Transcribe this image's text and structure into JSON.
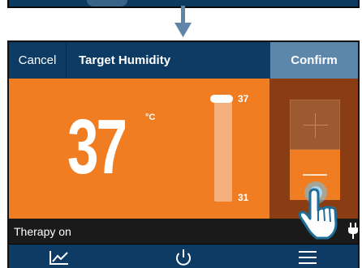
{
  "header": {
    "cancel_label": "Cancel",
    "title": "Target Humidity",
    "confirm_label": "Confirm"
  },
  "setpoint": {
    "value": "37",
    "unit": "°C",
    "range_max": "37",
    "range_min": "31"
  },
  "status": {
    "text": "Therapy on"
  },
  "nav": {
    "icons": [
      "chart-icon",
      "power-icon",
      "menu-icon"
    ]
  },
  "colors": {
    "accent": "#f07d22",
    "header": "#0e3b63",
    "confirm": "#5d87aa",
    "side_panel": "#8a3d12"
  }
}
